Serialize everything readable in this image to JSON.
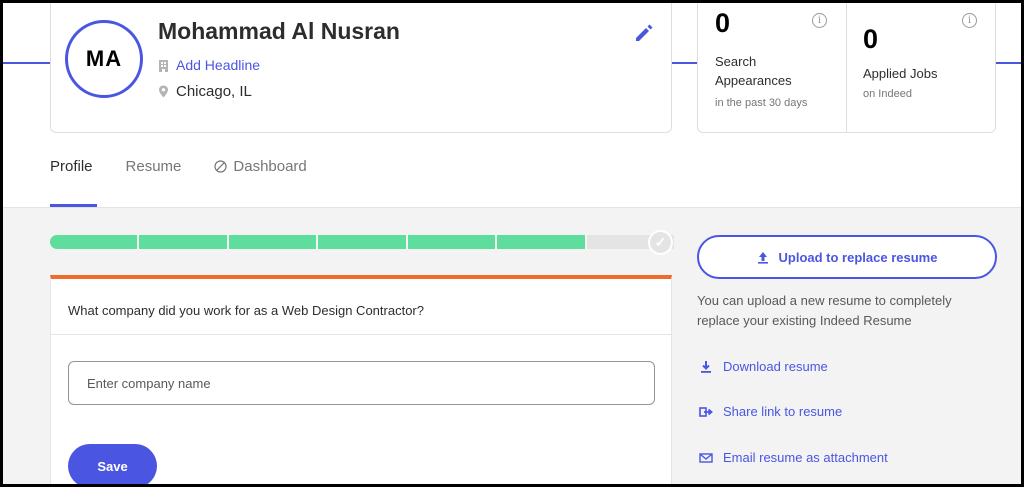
{
  "profile": {
    "initials": "MA",
    "name": "Mohammad Al Nusran",
    "headline_link": "Add Headline",
    "location": "Chicago, IL"
  },
  "stats": [
    {
      "value": "0",
      "label": "Search Appearances",
      "sub": "in the past 30 days"
    },
    {
      "value": "0",
      "label": "Applied Jobs",
      "sub": "on Indeed"
    }
  ],
  "tabs": [
    {
      "label": "Profile",
      "active": true
    },
    {
      "label": "Resume",
      "active": false
    },
    {
      "label": "Dashboard",
      "active": false
    }
  ],
  "progress": {
    "segments_total": 7,
    "segments_filled": 6
  },
  "question": {
    "text": "What company did you work for as a Web Design Contractor?",
    "input_placeholder": "Enter company name",
    "input_value": "",
    "save_label": "Save"
  },
  "resume_actions": {
    "upload_label": "Upload to replace resume",
    "upload_description": "You can upload a new resume to completely replace your existing Indeed Resume",
    "download_label": "Download resume",
    "share_label": "Share link to resume",
    "email_label": "Email resume as attachment"
  },
  "colors": {
    "accent": "#4a56e2",
    "progress_fill": "#5fdd9d",
    "card_top_border": "#f06a2b"
  },
  "icons": {
    "headline": "building-icon",
    "location": "map-pin-icon",
    "edit": "pencil-icon",
    "info": "info-icon",
    "dashboard": "disabled-icon",
    "upload": "upload-icon",
    "download": "download-icon",
    "share": "share-icon",
    "email": "envelope-icon"
  }
}
